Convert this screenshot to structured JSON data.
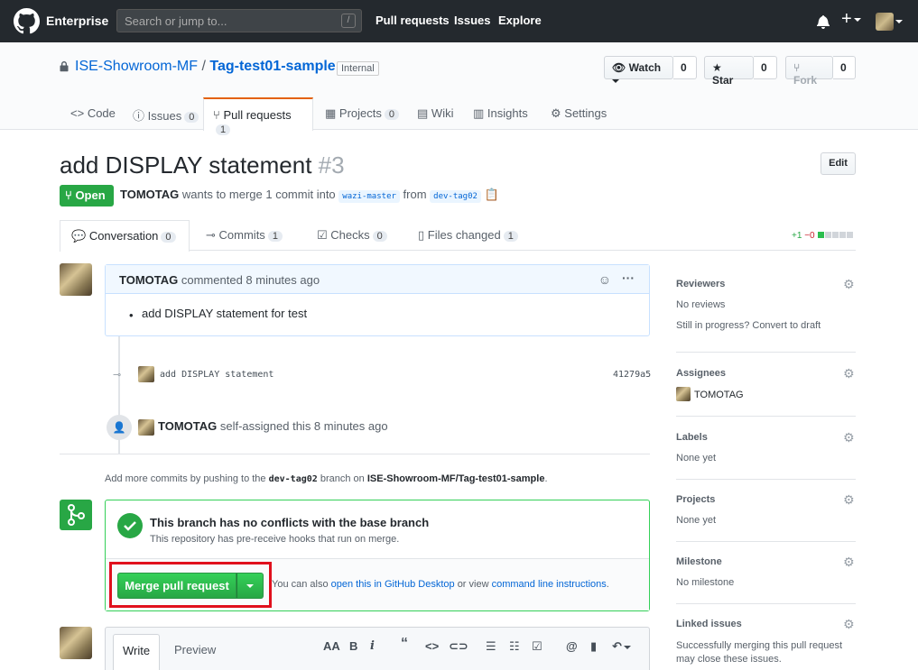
{
  "header": {
    "brand": "Enterprise",
    "search_placeholder": "Search or jump to...",
    "search_key": "/",
    "nav": [
      "Pull requests",
      "Issues",
      "Explore"
    ]
  },
  "repo": {
    "owner": "ISE-Showroom-MF",
    "separator": "/",
    "name": "Tag-test01-sample",
    "visibility": "Internal",
    "watch_label": "Watch",
    "watch_count": "0",
    "star_label": "Star",
    "star_count": "0",
    "fork_label": "Fork",
    "fork_count": "0",
    "tabs": [
      {
        "label": "Code",
        "count": null
      },
      {
        "label": "Issues",
        "count": "0"
      },
      {
        "label": "Pull requests",
        "count": "1"
      },
      {
        "label": "Projects",
        "count": "0"
      },
      {
        "label": "Wiki",
        "count": null
      },
      {
        "label": "Insights",
        "count": null
      },
      {
        "label": "Settings",
        "count": null
      }
    ]
  },
  "pr": {
    "title": "add DISPLAY statement",
    "number": "#3",
    "edit_label": "Edit",
    "state": "Open",
    "author": "TOMOTAG",
    "merge_text": "wants to merge 1 commit into",
    "base_branch": "wazi-master",
    "from_text": "from",
    "head_branch": "dev-tag02",
    "tabs": [
      {
        "label": "Conversation",
        "count": "0"
      },
      {
        "label": "Commits",
        "count": "1"
      },
      {
        "label": "Checks",
        "count": "0"
      },
      {
        "label": "Files changed",
        "count": "1"
      }
    ],
    "diff_add": "+1",
    "diff_del": "−0"
  },
  "timeline": {
    "comment_author": "TOMOTAG",
    "comment_meta": "commented 8 minutes ago",
    "comment_body": "add DISPLAY statement for test",
    "commit_message": "add DISPLAY statement",
    "commit_sha": "41279a5",
    "assign_user": "TOMOTAG",
    "assign_text": "self-assigned this 8 minutes ago",
    "push_hint_pre": "Add more commits by pushing to the",
    "push_hint_branch": "dev-tag02",
    "push_hint_mid": "branch on",
    "push_hint_repo": "ISE-Showroom-MF/Tag-test01-sample",
    "push_hint_post": "."
  },
  "merge": {
    "status_title": "This branch has no conflicts with the base branch",
    "status_sub": "This repository has pre-receive hooks that run on merge.",
    "button_label": "Merge pull request",
    "alt_pre": "You can also",
    "alt_link1": "open this in GitHub Desktop",
    "alt_mid": "or view",
    "alt_link2": "command line instructions",
    "alt_post": "."
  },
  "sidebar": {
    "reviewers_title": "Reviewers",
    "reviewers_value": "No reviews",
    "reviewers_hint": "Still in progress? Convert to draft",
    "assignees_title": "Assignees",
    "assignees_value": "TOMOTAG",
    "labels_title": "Labels",
    "labels_value": "None yet",
    "projects_title": "Projects",
    "projects_value": "None yet",
    "milestone_title": "Milestone",
    "milestone_value": "No milestone",
    "linked_title": "Linked issues",
    "linked_value": "Successfully merging this pull request may close these issues."
  },
  "composer": {
    "write_tab": "Write",
    "preview_tab": "Preview"
  }
}
